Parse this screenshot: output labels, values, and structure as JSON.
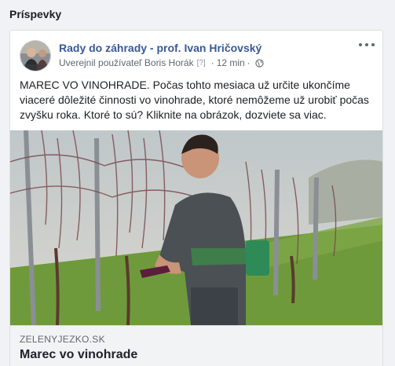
{
  "section": {
    "title": "Príspevky"
  },
  "post": {
    "page_name": "Rady do záhrady - prof. Ivan Hričovský",
    "meta_author": "Uverejnil používateľ Boris Horák",
    "meta_help": "[?]",
    "meta_dot": "·",
    "meta_time": "12 min",
    "meta_dot2": "·",
    "text": "MAREC VO VINOHRADE. Počas tohto mesiaca už určite ukončíme viaceré dôležité činnosti vo vinohrade, ktoré nemôžeme už urobiť počas zvyšku roka. Ktoré to sú? Kliknite na obrázok, dozviete sa viac.",
    "icons": {
      "more": "more-options-icon",
      "audience": "globe-icon"
    }
  },
  "link": {
    "domain": "ZELENYJEZKO.SK",
    "title": "Marec vo vinohrade"
  },
  "colors": {
    "page_name": "#385898",
    "link_bg": "#f2f3f5",
    "grass": "#6f9a3c"
  }
}
